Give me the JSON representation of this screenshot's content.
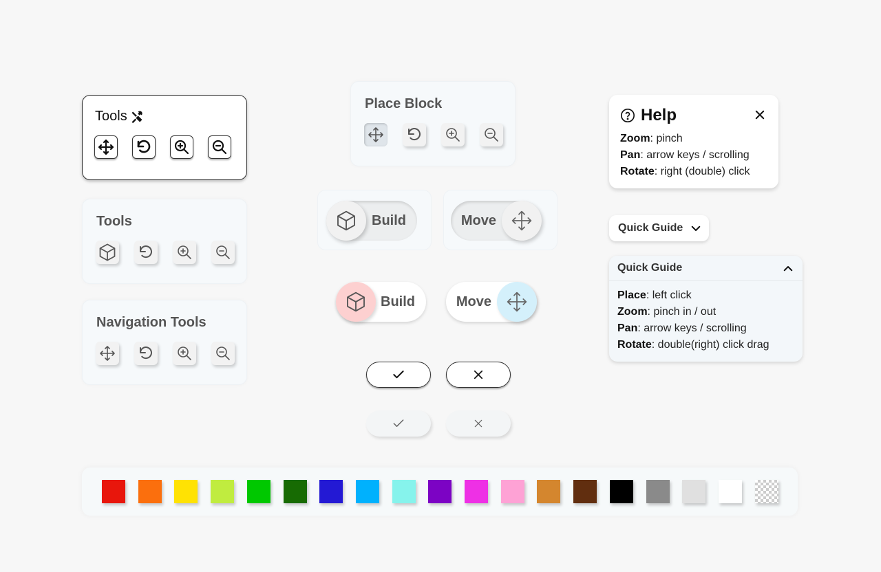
{
  "panel_classic": {
    "title": "Tools"
  },
  "panel_place": {
    "title": "Place Block"
  },
  "panel_tools": {
    "title": "Tools"
  },
  "panel_nav": {
    "title": "Navigation Tools"
  },
  "toggles": {
    "soft_build": "Build",
    "soft_move": "Move",
    "color_build": "Build",
    "color_move": "Move"
  },
  "help": {
    "title": "Help",
    "lines": [
      {
        "key": "Zoom",
        "value": ": pinch"
      },
      {
        "key": "Pan",
        "value": ": arrow keys / scrolling"
      },
      {
        "key": "Rotate",
        "value": ": right (double) click"
      }
    ]
  },
  "quick_guide_closed": {
    "label": "Quick Guide"
  },
  "quick_guide_open": {
    "label": "Quick Guide",
    "lines": [
      {
        "key": "Place",
        "value": ": left click"
      },
      {
        "key": "Zoom",
        "value": ": pinch in / out"
      },
      {
        "key": "Pan",
        "value": ": arrow keys / scrolling"
      },
      {
        "key": "Rotate",
        "value": ": double(right) click drag"
      }
    ]
  },
  "palette": {
    "colors": [
      "#e8160c",
      "#fb6f0d",
      "#ffe203",
      "#c0ec3f",
      "#00c800",
      "#176b03",
      "#2319d4",
      "#00b1fd",
      "#86f3ec",
      "#7c03c4",
      "#ee30e5",
      "#fea2d5",
      "#d4862e",
      "#612e0f",
      "#000000",
      "#8a8a8a",
      "#e0e0e0",
      "#ffffff",
      "transparent"
    ]
  }
}
